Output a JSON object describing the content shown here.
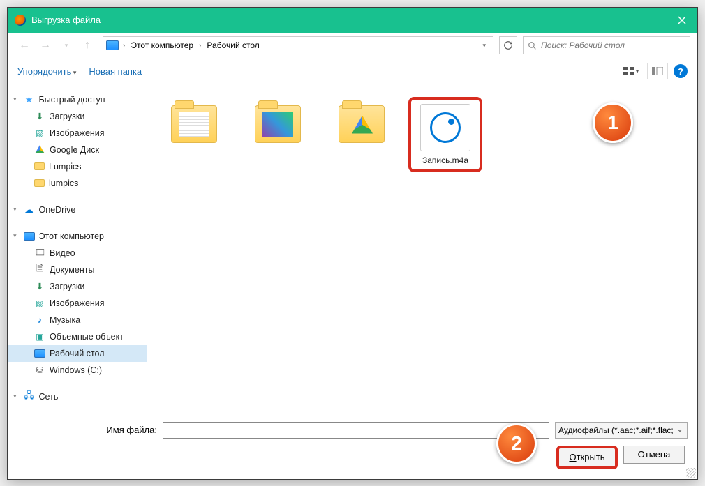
{
  "titlebar": {
    "title": "Выгрузка файла"
  },
  "breadcrumb": {
    "root": "Этот компьютер",
    "current": "Рабочий стол"
  },
  "search": {
    "placeholder": "Поиск: Рабочий стол"
  },
  "toolbar": {
    "organize": "Упорядочить",
    "new_folder": "Новая папка"
  },
  "sidebar": {
    "quick_access": "Быстрый доступ",
    "downloads": "Загрузки",
    "pictures": "Изображения",
    "gdrive": "Google Диск",
    "lumpics1": "Lumpics",
    "lumpics2": "lumpics",
    "onedrive": "OneDrive",
    "this_pc": "Этот компьютер",
    "video": "Видео",
    "documents": "Документы",
    "downloads2": "Загрузки",
    "pictures2": "Изображения",
    "music": "Музыка",
    "objects3d": "Объемные объект",
    "desktop": "Рабочий стол",
    "drive_c": "Windows (C:)",
    "network": "Сеть"
  },
  "files": {
    "f1": "",
    "f2": "",
    "f3": "",
    "audio": "Запись.m4a"
  },
  "callouts": {
    "one": "1",
    "two": "2"
  },
  "footer": {
    "filename_label_pre": "И",
    "filename_label_u": "м",
    "filename_label_post": "я файла:",
    "filetype": "Аудиофайлы (*.aac;*.aif;*.flac;",
    "open_u": "О",
    "open_post": "ткрыть",
    "cancel": "Отмена"
  }
}
